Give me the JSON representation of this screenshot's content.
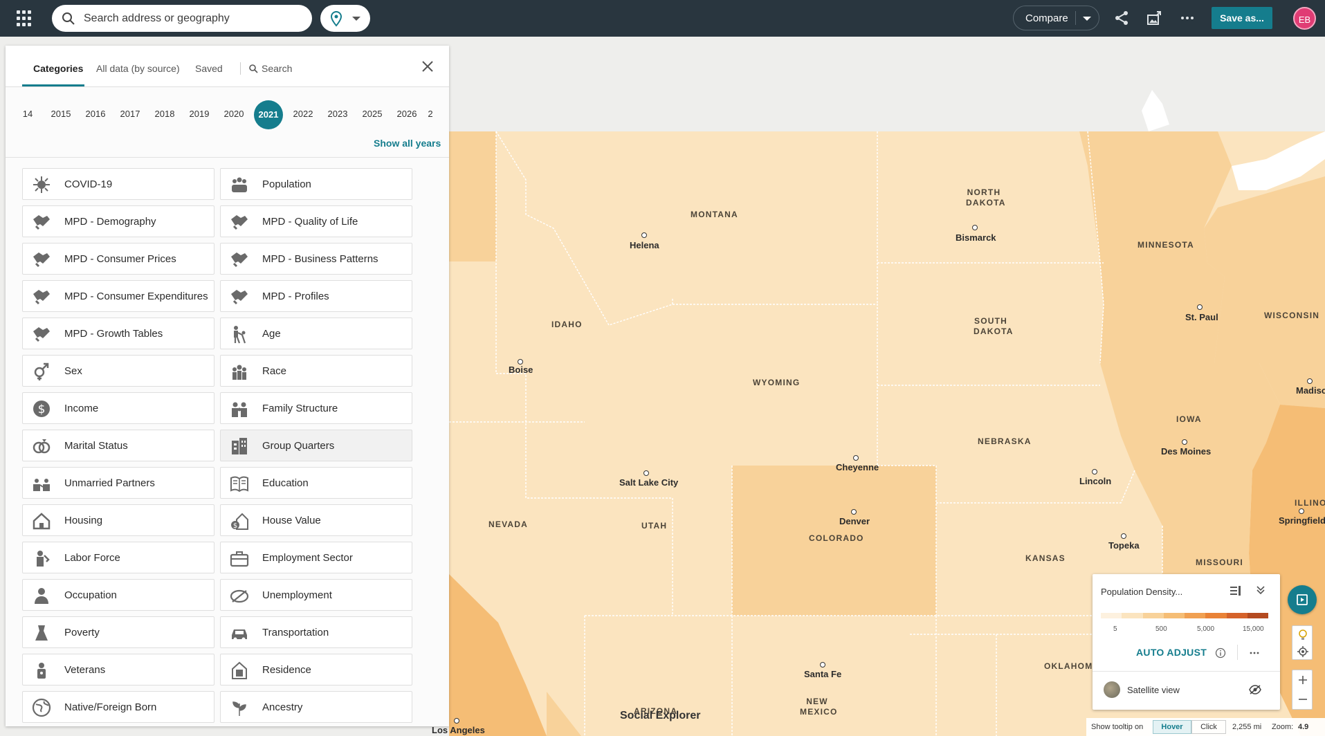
{
  "topbar": {
    "search_placeholder": "Search address or geography",
    "compare_label": "Compare",
    "save_label": "Save as...",
    "avatar_initials": "EB"
  },
  "panel": {
    "tabs": [
      {
        "label": "Categories",
        "active": true
      },
      {
        "label": "All data (by source)",
        "active": false
      },
      {
        "label": "Saved",
        "active": false
      },
      {
        "label": "Search",
        "active": false
      }
    ],
    "years": [
      "14",
      "2015",
      "2016",
      "2017",
      "2018",
      "2019",
      "2020",
      "2021",
      "2022",
      "2023",
      "2025",
      "2026",
      "2"
    ],
    "selected_year": "2021",
    "show_all_years": "Show all years",
    "categories_left": [
      {
        "label": "COVID-19",
        "icon": "virus-icon"
      },
      {
        "label": "MPD - Demography",
        "icon": "handshake-icon"
      },
      {
        "label": "MPD - Consumer Prices",
        "icon": "handshake-icon"
      },
      {
        "label": "MPD - Consumer Expenditures",
        "icon": "handshake-icon"
      },
      {
        "label": "MPD - Growth Tables",
        "icon": "handshake-icon"
      },
      {
        "label": "Sex",
        "icon": "gender-icon"
      },
      {
        "label": "Income",
        "icon": "dollar-icon"
      },
      {
        "label": "Marital Status",
        "icon": "rings-icon"
      },
      {
        "label": "Unmarried Partners",
        "icon": "partners-icon"
      },
      {
        "label": "Housing",
        "icon": "house-icon"
      },
      {
        "label": "Labor Force",
        "icon": "worker-icon"
      },
      {
        "label": "Occupation",
        "icon": "person-icon"
      },
      {
        "label": "Poverty",
        "icon": "poverty-icon"
      },
      {
        "label": "Veterans",
        "icon": "veteran-icon"
      },
      {
        "label": "Native/Foreign Born",
        "icon": "globe-icon"
      }
    ],
    "categories_right": [
      {
        "label": "Population",
        "icon": "people-icon"
      },
      {
        "label": "MPD - Quality of Life",
        "icon": "handshake-icon"
      },
      {
        "label": "MPD - Business Patterns",
        "icon": "handshake-icon"
      },
      {
        "label": "MPD - Profiles",
        "icon": "handshake-icon"
      },
      {
        "label": "Age",
        "icon": "age-icon"
      },
      {
        "label": "Race",
        "icon": "race-icon"
      },
      {
        "label": "Family Structure",
        "icon": "family-icon"
      },
      {
        "label": "Group Quarters",
        "icon": "building-icon"
      },
      {
        "label": "Education",
        "icon": "book-icon"
      },
      {
        "label": "House Value",
        "icon": "house-value-icon"
      },
      {
        "label": "Employment Sector",
        "icon": "briefcase-icon"
      },
      {
        "label": "Unemployment",
        "icon": "unemployment-icon"
      },
      {
        "label": "Transportation",
        "icon": "car-icon"
      },
      {
        "label": "Residence",
        "icon": "residence-icon"
      },
      {
        "label": "Ancestry",
        "icon": "tree-icon"
      }
    ]
  },
  "map": {
    "states": [
      {
        "name": "MONTANA"
      },
      {
        "name": "NORTH DAKOTA"
      },
      {
        "name": "MINNESOTA"
      },
      {
        "name": "IDAHO"
      },
      {
        "name": "SOUTH DAKOTA"
      },
      {
        "name": "WISCONSIN"
      },
      {
        "name": "WYOMING"
      },
      {
        "name": "IOWA"
      },
      {
        "name": "NEBRASKA"
      },
      {
        "name": "NEVADA"
      },
      {
        "name": "UTAH"
      },
      {
        "name": "COLORADO"
      },
      {
        "name": "KANSAS"
      },
      {
        "name": "MISSOURI"
      },
      {
        "name": "ILLINO"
      },
      {
        "name": "OKLAHOMA"
      },
      {
        "name": "NEW MEXICO"
      },
      {
        "name": "ARIZONA"
      }
    ],
    "cities": [
      {
        "name": "Helena"
      },
      {
        "name": "Bismarck"
      },
      {
        "name": "St. Paul"
      },
      {
        "name": "Boise"
      },
      {
        "name": "Madison"
      },
      {
        "name": "Des Moines"
      },
      {
        "name": "Cheyenne"
      },
      {
        "name": "Salt Lake City"
      },
      {
        "name": "Lincoln"
      },
      {
        "name": "Denver"
      },
      {
        "name": "Springfield"
      },
      {
        "name": "Topeka"
      },
      {
        "name": "Santa Fe"
      },
      {
        "name": "Los Angeles"
      }
    ],
    "brand": "Social Explorer"
  },
  "legend": {
    "title": "Population Density...",
    "ticks": [
      "5",
      "500",
      "5,000",
      "15,000"
    ],
    "colors": [
      "#fdf1df",
      "#fbe4bf",
      "#f8d29a",
      "#f5bd75",
      "#f0a052",
      "#e98236",
      "#d5622a",
      "#b44a20"
    ],
    "auto_adjust": "AUTO ADJUST",
    "satellite": "Satellite view"
  },
  "status": {
    "tooltip_label": "Show tooltip on",
    "hover": "Hover",
    "click": "Click",
    "distance": "2,255 mi",
    "zoom_label": "Zoom:",
    "zoom_value": "4.9"
  },
  "colors": {
    "accent": "#157d8d",
    "topbar": "#29363f",
    "map_light": "#fbe4bf",
    "map_mid": "#f8d29a"
  }
}
